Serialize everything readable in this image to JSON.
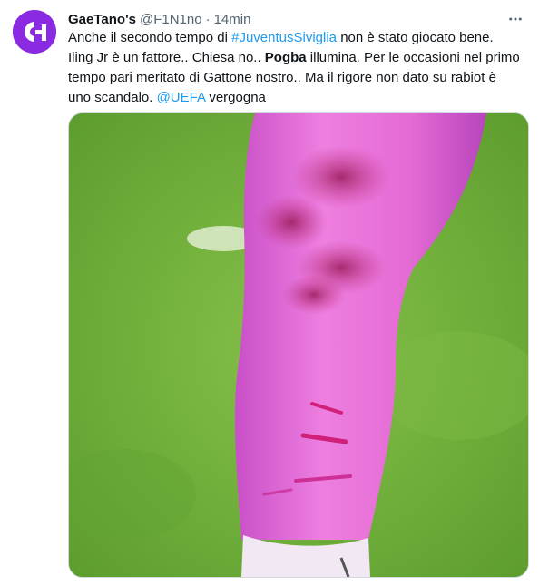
{
  "author": {
    "name": "GaeTano's",
    "handle": "@F1N1no",
    "separator": "·",
    "time": "14min"
  },
  "avatar": {
    "bg_color": "#8a2be2",
    "icon": "gc-logo-icon"
  },
  "more_icon": "more-horizontal-icon",
  "tweet": {
    "line1_a": "Anche il secondo tempo di ",
    "line1_hashtag": "#JuventusSiviglia",
    "line1_b": " non è stato giocato bene.",
    "line2_a": "Iling Jr è un fattore.. Chiesa no.. ",
    "line2_bold": "Pogba",
    "line2_b": " illumina. Per le occasioni nel primo",
    "line3": "tempo pari meritato di Gattone nostro.. Ma il rigore non dato su rabiot è",
    "line4_a": "uno scandalo. ",
    "line4_mention": "@UEFA",
    "line4_b": " vergogna"
  },
  "colors": {
    "link": "#1d9bf0",
    "secondary_text": "#536471",
    "pitch_green": "#6fb23a",
    "skin_magenta": "#e86ad6"
  },
  "media": {
    "description_icon": "photo-leg-bruises"
  }
}
